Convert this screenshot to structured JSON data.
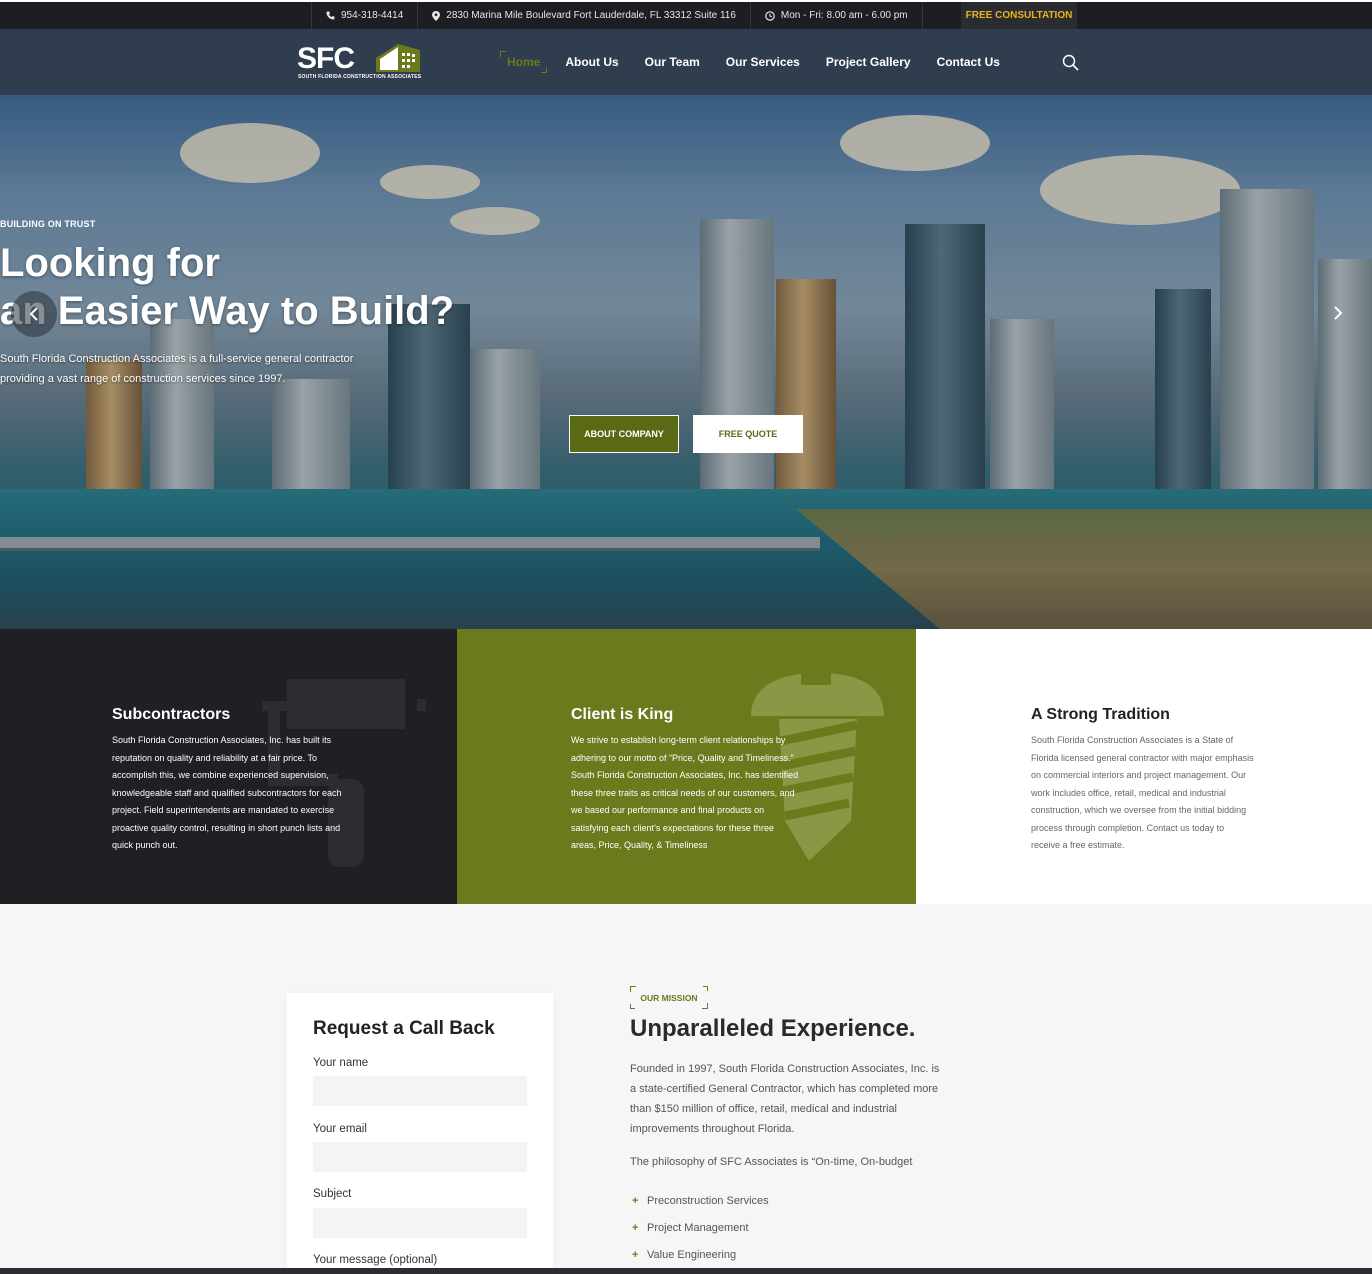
{
  "topbar": {
    "phone": "954-318-4414",
    "address": "2830 Marina Mile Boulevard Fort Lauderdale, FL 33312 Suite 116",
    "hours": "Mon - Fri: 8.00 am - 6.00 pm",
    "cta": "FREE CONSULTATION",
    "icons": [
      "phone-icon",
      "map-pin-icon",
      "clock-icon"
    ]
  },
  "logo": {
    "letters": "SFC",
    "tagline": "SOUTH FLORIDA CONSTRUCTION ASSOCIATES"
  },
  "nav": {
    "items": [
      {
        "label": "Home",
        "active": true
      },
      {
        "label": "About Us"
      },
      {
        "label": "Our Team"
      },
      {
        "label": "Our Services"
      },
      {
        "label": "Project Gallery"
      },
      {
        "label": "Contact Us"
      }
    ]
  },
  "hero": {
    "kicker": "BUILDING ON TRUST",
    "title_line1": "Looking for",
    "title_line2": "an Easier Way to Build?",
    "subtitle_line1": "South Florida Construction Associates is a full-service general contractor",
    "subtitle_line2": "providing a vast range of construction services since 1997.",
    "btn_primary": "ABOUT COMPANY",
    "btn_secondary": "FREE QUOTE"
  },
  "features": [
    {
      "title": "Subcontractors",
      "text": "South Florida Construction Associates, Inc. has built its reputation on quality and reliability at a fair price. To accomplish this, we combine experienced supervision, knowledgeable staff and qualified subcontractors for each project. Field superintendents are mandated to exercise proactive quality control, resulting in short punch lists and quick punch out."
    },
    {
      "title": "Client is King",
      "text": "We strive to establish long-term client relationships by adhering to our motto of “Price, Quality and Timeliness.” South Florida Construction Associates, Inc. has identified these three traits as critical needs of our customers, and we based our performance and final products on satisfying each client’s expectations for these three areas, Price, Quality, & Timeliness"
    },
    {
      "title": "A Strong Tradition",
      "text": "South Florida Construction Associates is a State of Florida licensed general contractor with major emphasis on commercial interiors and project management. Our work includes office, retail, medical and industrial construction, which we oversee from the initial bidding process through completion. Contact us today to receive a free estimate."
    }
  ],
  "form": {
    "title": "Request a Call Back",
    "name_label": "Your name",
    "email_label": "Your email",
    "subject_label": "Subject",
    "message_label": "Your message (optional)"
  },
  "mission": {
    "tag": "OUR MISSION",
    "title": "Unparalleled Experience.",
    "paragraph": "Founded in 1997, South Florida Construction Associates, Inc. is a state-certified General Contractor, which has completed more than $150 million of office, retail, medical and industrial improvements throughout Florida.",
    "philosophy": "The philosophy of SFC Associates is “On-time, On-budget",
    "list": [
      "Preconstruction Services",
      "Project Management",
      "Value Engineering"
    ]
  },
  "colors": {
    "accent_green": "#6b7a1d",
    "nav_bg": "#2f3d4f",
    "dark": "#1f2024",
    "cta_yellow": "#e8b31c"
  }
}
